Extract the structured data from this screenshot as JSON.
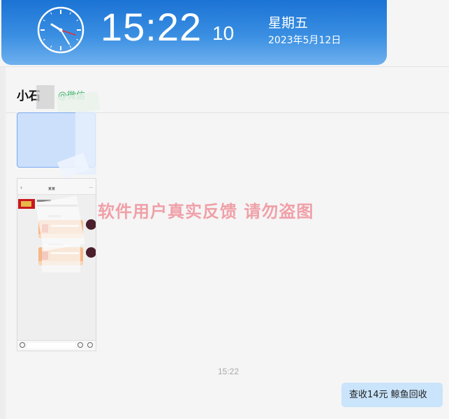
{
  "clock": {
    "time": "15:22",
    "seconds": "10",
    "weekday": "星期五",
    "date": "2023年5月12日"
  },
  "chat": {
    "contact_name": "小石",
    "contact_tag": "@微信",
    "watermark": "软件用户真实反馈  请勿盗图",
    "timestamp": "15:22",
    "sent_message": "查收14元   鲸鱼回收"
  },
  "phone_screenshot": {
    "back_glyph": "‹",
    "title": "某某",
    "menu_glyph": "···"
  },
  "colors": {
    "banner": "#1b73d4",
    "sent_bubble": "#c9e4fb",
    "watermark": "#f0a0a8",
    "contact_tag": "#3fb46a"
  }
}
